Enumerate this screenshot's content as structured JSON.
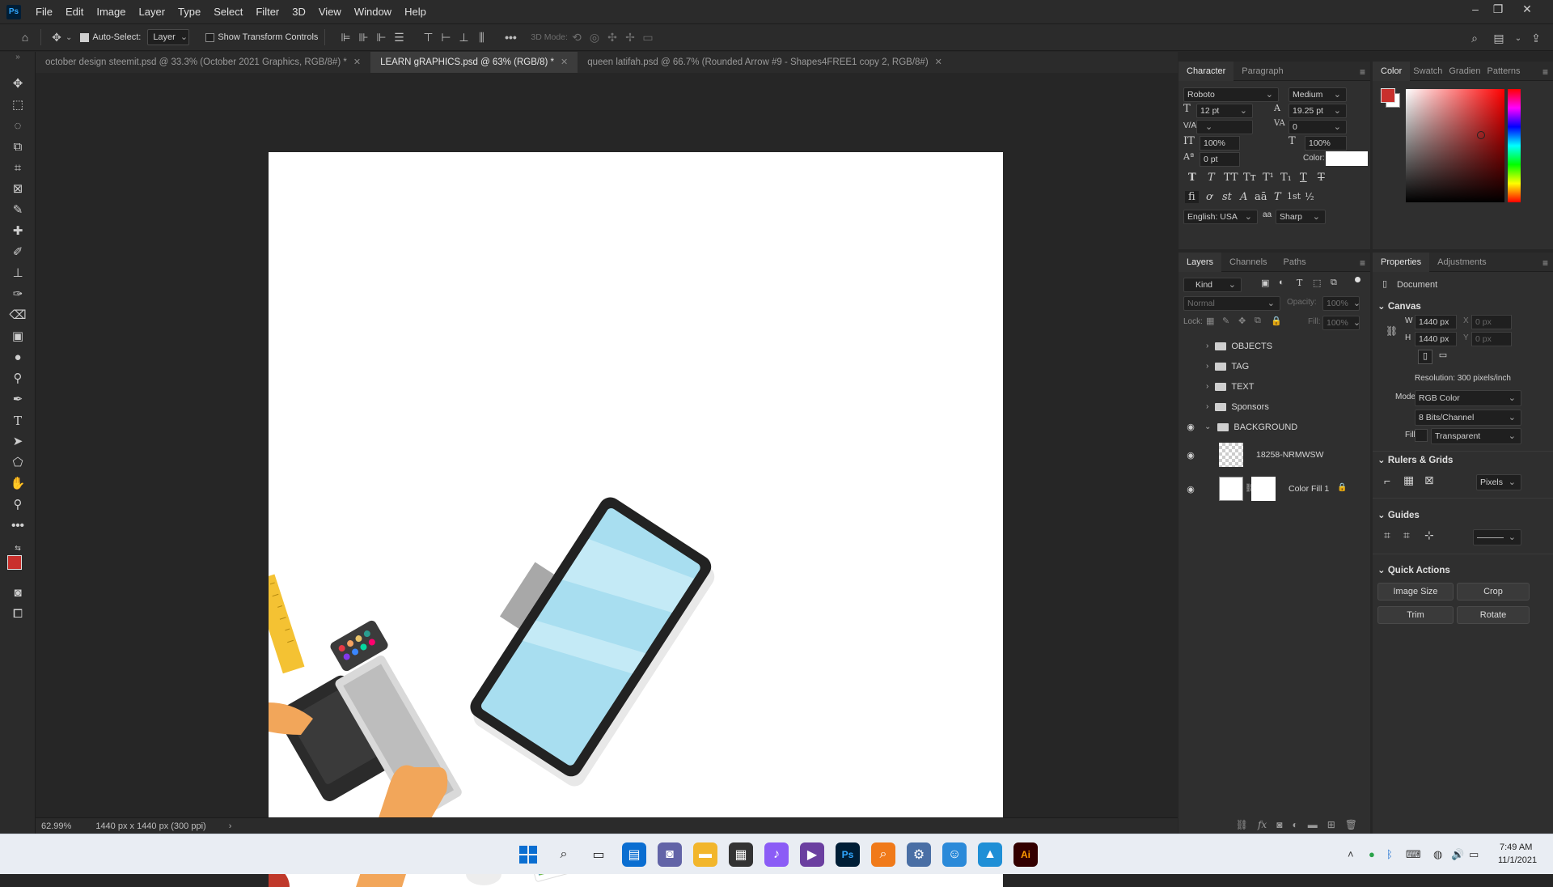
{
  "menubar": {
    "logo": "Ps",
    "items": [
      "File",
      "Edit",
      "Image",
      "Layer",
      "Type",
      "Select",
      "Filter",
      "3D",
      "View",
      "Window",
      "Help"
    ]
  },
  "options": {
    "auto_select_label": "Auto-Select:",
    "auto_select_target": "Layer",
    "show_transform_label": "Show Transform Controls",
    "mode_3d_label": "3D Mode:"
  },
  "tabs": [
    {
      "label": "october design steemit.psd @ 33.3% (October 2021  Graphics, RGB/8#) *",
      "active": false
    },
    {
      "label": "LEARN gRAPHICS.psd @ 63% (RGB/8) *",
      "active": true
    },
    {
      "label": "queen latifah.psd @ 66.7% (Rounded Arrow #9 - Shapes4FREE1 copy 2, RGB/8#)",
      "active": false
    }
  ],
  "status": {
    "zoom": "62.99%",
    "doc_size": "1440 px x 1440 px (300 ppi)"
  },
  "character": {
    "tabs": [
      "Character",
      "Paragraph"
    ],
    "font_family": "Roboto",
    "font_style": "Medium",
    "size": "12 pt",
    "leading": "19.25 pt",
    "kerning": "V/A",
    "tracking": "0",
    "vscale": "100%",
    "hscale": "100%",
    "baseline": "0 pt",
    "color_label": "Color:",
    "language": "English: USA",
    "antialias": "Sharp",
    "aa_label": "aa"
  },
  "color": {
    "tabs": [
      "Color",
      "Swatch",
      "Gradien",
      "Patterns"
    ],
    "foreground": "#c9302c",
    "background": "#ffffff"
  },
  "layers": {
    "tabs": [
      "Layers",
      "Channels",
      "Paths"
    ],
    "filter": "Kind",
    "blend": "Normal",
    "opacity_label": "Opacity:",
    "opacity": "100%",
    "lock_label": "Lock:",
    "fill_label": "Fill:",
    "fill": "100%",
    "items": [
      {
        "name": "OBJECTS",
        "type": "group",
        "visible": false
      },
      {
        "name": "TAG",
        "type": "group",
        "visible": false
      },
      {
        "name": "TEXT",
        "type": "group",
        "visible": false
      },
      {
        "name": "Sponsors",
        "type": "group",
        "visible": false
      },
      {
        "name": "BACKGROUND",
        "type": "group-open",
        "visible": true
      },
      {
        "name": "18258-NRMWSW",
        "type": "smart",
        "visible": true
      },
      {
        "name": "Color Fill 1",
        "type": "fill",
        "visible": true
      }
    ]
  },
  "properties": {
    "tabs": [
      "Properties",
      "Adjustments"
    ],
    "kind": "Document",
    "canvas_title": "Canvas",
    "w_label": "W",
    "w": "1440 px",
    "h_label": "H",
    "h": "1440 px",
    "x_label": "X",
    "x": "0 px",
    "y_label": "Y",
    "y": "0 px",
    "resolution": "Resolution: 300 pixels/inch",
    "mode_label": "Mode",
    "mode": "RGB Color",
    "depth": "8 Bits/Channel",
    "fill_label": "Fill",
    "fill": "Transparent",
    "rulers_title": "Rulers & Grids",
    "units": "Pixels",
    "guides_title": "Guides",
    "quick_title": "Quick Actions",
    "btn_image_size": "Image Size",
    "btn_crop": "Crop",
    "btn_trim": "Trim",
    "btn_rotate": "Rotate"
  },
  "clock": {
    "time": "7:49 AM",
    "date": "11/1/2021"
  }
}
